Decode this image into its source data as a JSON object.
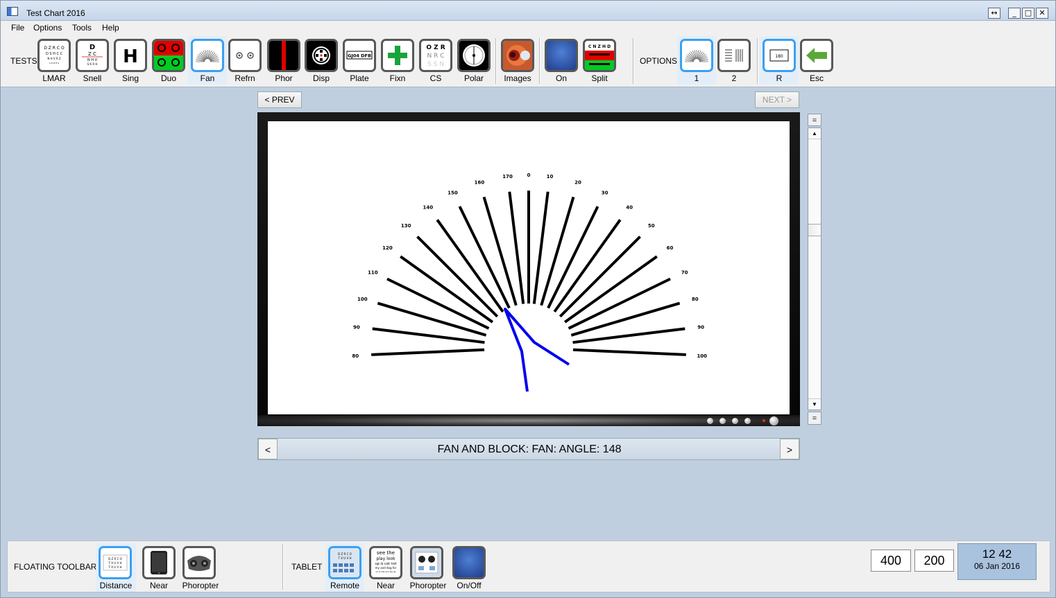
{
  "window": {
    "title": "Test Chart 2016",
    "restore_glyph": "↔",
    "minimize_glyph": "_",
    "maximize_glyph": "□",
    "close_glyph": "✕"
  },
  "menu": [
    "File",
    "Options",
    "Tools",
    "Help"
  ],
  "toolbar": {
    "tests_label": "TESTS",
    "options_label": "OPTIONS",
    "buttons": [
      {
        "label": "LMAR",
        "icon": "lmar-chart-icon"
      },
      {
        "label": "Snell",
        "icon": "snellen-chart-icon"
      },
      {
        "label": "Sing",
        "icon": "single-letter-icon",
        "glyph": "H"
      },
      {
        "label": "Duo",
        "icon": "duochrome-icon"
      },
      {
        "label": "Fan",
        "icon": "fan-icon"
      },
      {
        "label": "Refrn",
        "icon": "refraction-icon"
      },
      {
        "label": "Phor",
        "icon": "phoria-icon"
      },
      {
        "label": "Disp",
        "icon": "disparity-icon"
      },
      {
        "label": "Plate",
        "icon": "plate-icon",
        "glyph": "GJ04 DFB"
      },
      {
        "label": "Fixn",
        "icon": "fixation-cross-icon"
      },
      {
        "label": "CS",
        "icon": "contrast-sensitivity-icon",
        "glyph": "O Z R\nN R C\nS S N"
      },
      {
        "label": "Polar",
        "icon": "polar-icon"
      },
      {
        "label": "Images",
        "icon": "eye-image-icon"
      },
      {
        "label": "On",
        "icon": "on-screen-icon"
      },
      {
        "label": "Split",
        "icon": "split-chart-icon",
        "glyph": "C N Z H D"
      },
      {
        "label": "1",
        "icon": "fan-option-icon"
      },
      {
        "label": "2",
        "icon": "lines-option-icon"
      },
      {
        "label": "R",
        "icon": "reverse-icon",
        "glyph": "180"
      },
      {
        "label": "Esc",
        "icon": "back-arrow-icon"
      }
    ]
  },
  "nav": {
    "prev": "< PREV",
    "next": "NEXT >"
  },
  "fan": {
    "left_labels": [
      "170",
      "160",
      "150",
      "140",
      "130",
      "120",
      "110",
      "100",
      "90",
      "80"
    ],
    "top_label": "0",
    "right_labels": [
      "10",
      "20",
      "30",
      "40",
      "50",
      "60",
      "70",
      "80",
      "90",
      "100"
    ]
  },
  "scroll": {
    "top": "=",
    "up": "▲",
    "down": "▼",
    "bottom": "="
  },
  "status": {
    "text": "FAN AND BLOCK: FAN: ANGLE:   148",
    "left": "<",
    "right": ">"
  },
  "bottom": {
    "floating_label": "FLOATING TOOLBAR",
    "tablet_label": "TABLET",
    "floating": [
      {
        "label": "Distance",
        "icon": "distance-chart-icon"
      },
      {
        "label": "Near",
        "icon": "tablet-icon"
      },
      {
        "label": "Phoropter",
        "icon": "phoropter-icon"
      }
    ],
    "tablet": [
      {
        "label": "Remote",
        "icon": "remote-icon"
      },
      {
        "label": "Near",
        "icon": "near-text-icon",
        "glyph": "see the\nplay look\nup is cat not\nmy and dog for"
      },
      {
        "label": "Phoropter",
        "icon": "phoropter-tablet-icon"
      },
      {
        "label": "On/Off",
        "icon": "onoff-icon"
      }
    ],
    "value_a": "400",
    "value_b": "200",
    "clock_time": "12 42",
    "clock_date": "06 Jan 2016"
  },
  "colors": {
    "accent": "#3c9ff0",
    "pointer": "#0000ee",
    "background": "#bfcfdf"
  }
}
